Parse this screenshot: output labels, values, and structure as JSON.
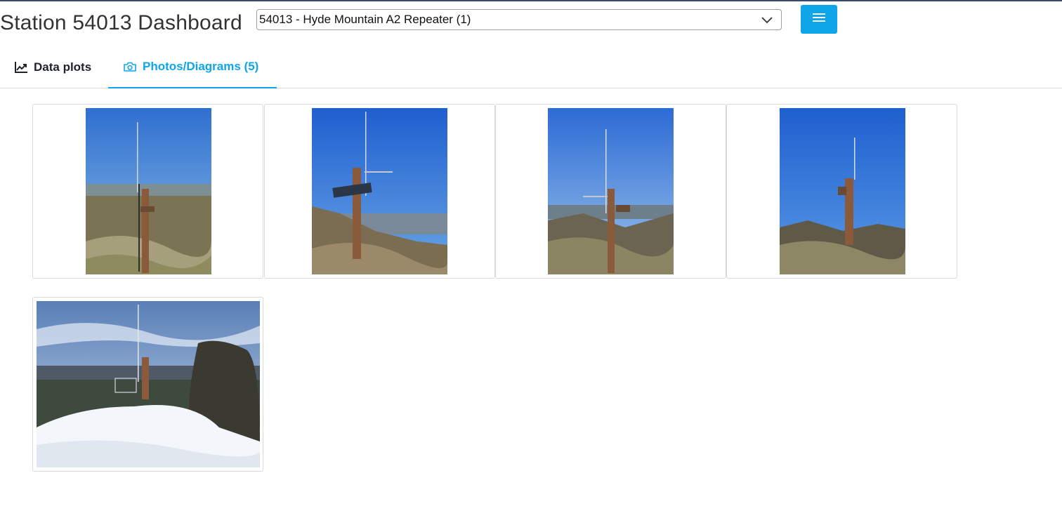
{
  "page": {
    "title": "Station 54013 Dashboard"
  },
  "station_select": {
    "value": "54013 - Hyde Mountain A2 Repeater (1)"
  },
  "menu_button": {
    "icon": "hamburger-menu-icon"
  },
  "tabs": [
    {
      "label": "Data plots",
      "icon": "line-chart-icon",
      "active": false
    },
    {
      "label": "Photos/Diagrams (5)",
      "icon": "camera-icon",
      "active": true
    }
  ],
  "photos": [
    {
      "name": "station-photo-1"
    },
    {
      "name": "station-photo-2"
    },
    {
      "name": "station-photo-3"
    },
    {
      "name": "station-photo-4"
    },
    {
      "name": "station-photo-5"
    }
  ],
  "colors": {
    "accent": "#0ea5e9",
    "text": "#333333",
    "border": "#d9d9d9"
  }
}
